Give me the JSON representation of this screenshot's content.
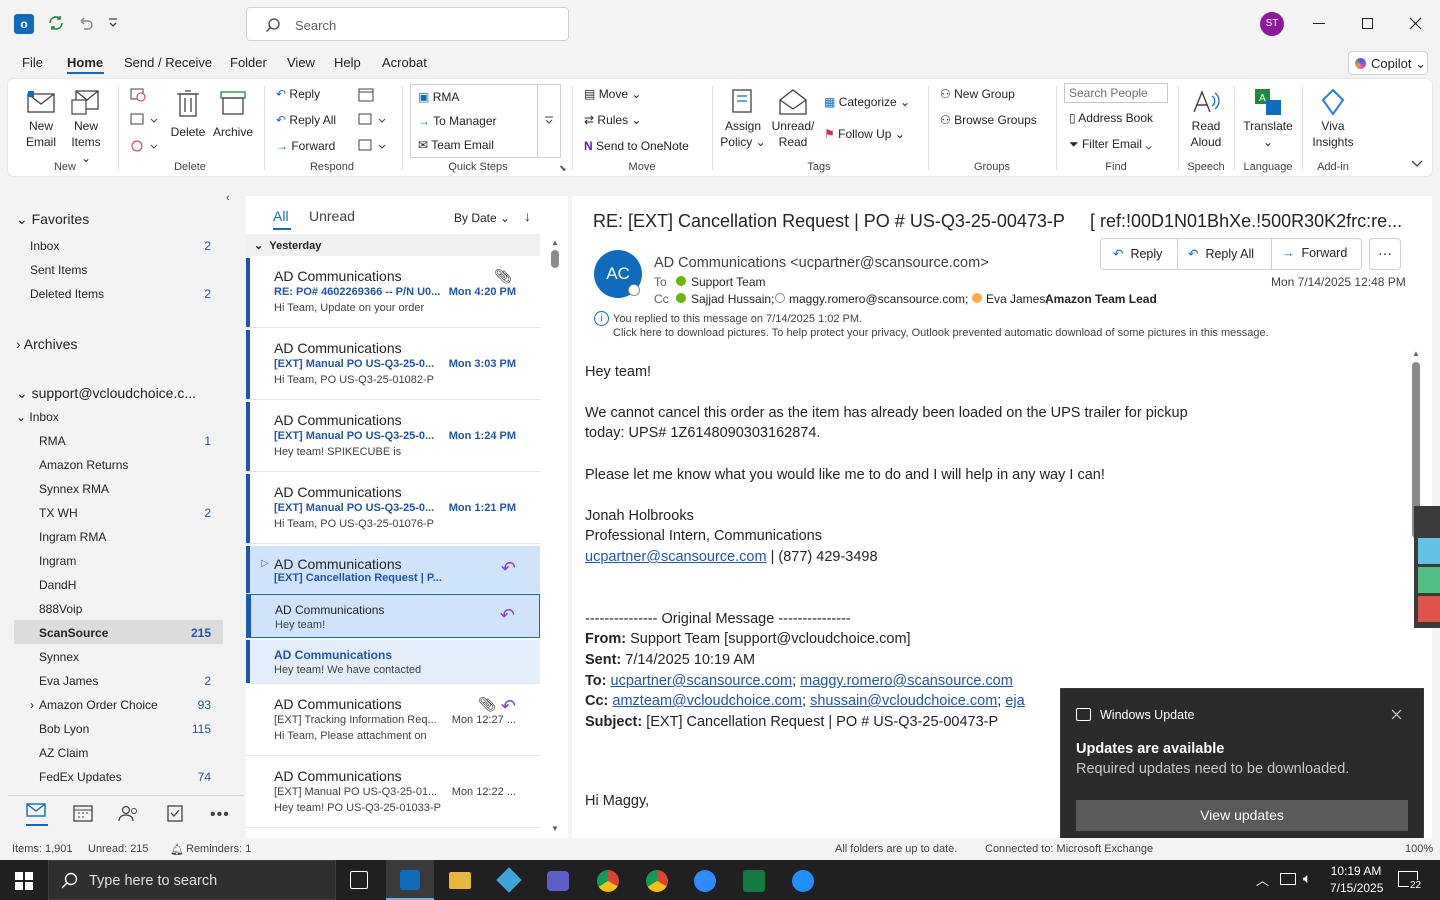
{
  "app": {
    "user_initials": "ST",
    "search_placeholder": "Search",
    "copilot": "Copilot"
  },
  "menu": [
    "File",
    "Home",
    "Send / Receive",
    "Folder",
    "View",
    "Help",
    "Acrobat"
  ],
  "ribbon": {
    "new_email": [
      "New",
      "Email"
    ],
    "new_items": [
      "New",
      "Items"
    ],
    "delete": "Delete",
    "archive": "Archive",
    "reply": "Reply",
    "reply_all": "Reply All",
    "forward": "Forward",
    "qs_rma": "RMA",
    "qs_manager": "To Manager",
    "qs_team": "Team Email",
    "move": "Move",
    "rules": "Rules",
    "onenote": "Send to OneNote",
    "assign_policy": [
      "Assign",
      "Policy"
    ],
    "unread_read": [
      "Unread/",
      "Read"
    ],
    "categorize": "Categorize",
    "follow_up": "Follow Up",
    "new_group": "New Group",
    "browse_groups": "Browse Groups",
    "search_people": "Search People",
    "address_book": "Address Book",
    "filter_email": "Filter Email",
    "read_aloud": [
      "Read",
      "Aloud"
    ],
    "translate": "Translate",
    "viva": [
      "Viva",
      "Insights"
    ],
    "groups": [
      "New",
      "Delete",
      "Respond",
      "Quick Steps",
      "Move",
      "Tags",
      "Groups",
      "Find",
      "Speech",
      "Language",
      "Add-in"
    ]
  },
  "folders": {
    "favorites_header": "Favorites",
    "favorites": [
      {
        "name": "Inbox",
        "count": "2"
      },
      {
        "name": "Sent Items",
        "count": ""
      },
      {
        "name": "Deleted Items",
        "count": "2"
      }
    ],
    "archives": "Archives",
    "account": "support@vcloudchoice.c...",
    "inbox": "Inbox",
    "subfolders": [
      {
        "name": "RMA",
        "count": "1"
      },
      {
        "name": "Amazon Returns",
        "count": ""
      },
      {
        "name": "Synnex RMA",
        "count": ""
      },
      {
        "name": "TX WH",
        "count": "2"
      },
      {
        "name": "Ingram RMA",
        "count": ""
      },
      {
        "name": "Ingram",
        "count": ""
      },
      {
        "name": "DandH",
        "count": ""
      },
      {
        "name": "888Voip",
        "count": ""
      },
      {
        "name": "ScanSource",
        "count": "215"
      },
      {
        "name": "Synnex",
        "count": ""
      },
      {
        "name": "Eva James",
        "count": "2"
      },
      {
        "name": "Amazon Order Choice",
        "count": "93"
      },
      {
        "name": "Bob Lyon",
        "count": "115"
      },
      {
        "name": "AZ Claim",
        "count": ""
      },
      {
        "name": "FedEx Updates",
        "count": "74"
      }
    ]
  },
  "list": {
    "tab_all": "All",
    "tab_unread": "Unread",
    "sort": "By Date",
    "group_header": "Yesterday",
    "messages": [
      {
        "from": "AD Communications",
        "subject": "RE: PO# 4602269366 -- P/N U0...",
        "time": "Mon 4:20 PM",
        "preview": "Hi Team,   Update on your order"
      },
      {
        "from": "AD Communications",
        "subject": "[EXT] Manual PO   US-Q3-25-0...",
        "time": "Mon 3:03 PM",
        "preview": "Hi Team,   PO US-Q3-25-01082-P"
      },
      {
        "from": "AD Communications",
        "subject": "[EXT] Manual PO   US-Q3-25-0...",
        "time": "Mon 1:24 PM",
        "preview": "Hey team!  SPIKECUBE is"
      },
      {
        "from": "AD Communications",
        "subject": "[EXT] Manual PO   US-Q3-25-0...",
        "time": "Mon 1:21 PM",
        "preview": "Hi Team,   PO US-Q3-25-01076-P"
      },
      {
        "from": "AD Communications",
        "subject": "[EXT] Cancellation Request | P...",
        "time": "",
        "preview": ""
      },
      {
        "from": "AD Communications",
        "subject": "",
        "time": "",
        "preview": "Hey team!"
      },
      {
        "from": "AD Communications",
        "subject": "",
        "time": "",
        "preview": "Hey team!  We have contacted"
      },
      {
        "from": "AD Communications",
        "subject": "[EXT] Tracking Information Req...",
        "time": "Mon 12:27 ...",
        "preview": "Hi Team,   Please attachment on"
      },
      {
        "from": "AD Communications",
        "subject": "[EXT] Manual PO   US-Q3-25-01...",
        "time": "Mon 12:22 ...",
        "preview": "Hey team!  PO US-Q3-25-01033-P"
      }
    ]
  },
  "reading": {
    "subject": "RE: [EXT] Cancellation Request | PO # US-Q3-25-00473-P",
    "ref": "[ ref:!00D1N01BhXe.!500R30K2frc:re...",
    "avatar": "AC",
    "sender": "AD Communications <ucpartner@scansource.com>",
    "to_label": "To",
    "to": "Support Team",
    "cc_label": "Cc",
    "cc1": "Sajjad Hussain;",
    "cc2": "maggy.romero@scansource.com;",
    "cc3": "Eva James;",
    "cc4": "Amazon Team Lead",
    "date": "Mon 7/14/2025 12:48 PM",
    "reply": "Reply",
    "reply_all": "Reply All",
    "forward": "Forward",
    "info1": "You replied to this message on 7/14/2025 1:02 PM.",
    "info2": "Click here to download pictures. To help protect your privacy, Outlook prevented automatic download of some pictures in this message.",
    "body": {
      "greeting": "Hey team!",
      "p1a": "We cannot cancel this order as the item has already been loaded on the UPS trailer for pickup",
      "p1b": "today:  UPS# 1Z6148090303162874.",
      "p2": "Please let me know what you would like me to do and I will help in any way I can!",
      "sig_name": "Jonah Holbrooks",
      "sig_title": "Professional Intern, Communications",
      "sig_email": "ucpartner@scansource.com",
      "sig_phone": " | (877) 429-3498",
      "orig": "--------------- Original Message ---------------",
      "from_label": "From:",
      "from_val": " Support Team [support@vcloudchoice.com]",
      "sent_label": "Sent:",
      "sent_val": " 7/14/2025 10:19 AM",
      "to_label": "To:",
      "to_link1": "ucpartner@scansource.com",
      "to_sep": "; ",
      "to_link2": "maggy.romero@scansource.com",
      "cc_label": "Cc:",
      "cc_link1": "amzteam@vcloudchoice.com",
      "cc_sep": "; ",
      "cc_link2": "shussain@vcloudchoice.com",
      "cc_sep2": "; ",
      "cc_link3": "eja",
      "subj_label": "Subject:",
      "subj_val": " [EXT] Cancellation Request | PO # US-Q3-25-00473-P",
      "hi": "Hi Maggy,"
    }
  },
  "toast": {
    "app": "Windows Update",
    "title": "Updates are available",
    "text": "Required updates need to be downloaded.",
    "button": "View updates"
  },
  "status": {
    "items": "Items: 1,901",
    "unread": "Unread: 215",
    "reminders": "Reminders: 1",
    "sync": "All folders are up to date.",
    "connected": "Connected to: Microsoft Exchange",
    "zoom": "100%"
  },
  "taskbar": {
    "search": "Type here to search",
    "time": "10:19 AM",
    "date": "7/15/2025",
    "notif": "22"
  },
  "colors": {
    "accent": "#0f6cbd",
    "unread_blue": "#1f55b0",
    "avatar_bg": "#0f6cbd",
    "user_avatar": "#8b1a9c"
  }
}
